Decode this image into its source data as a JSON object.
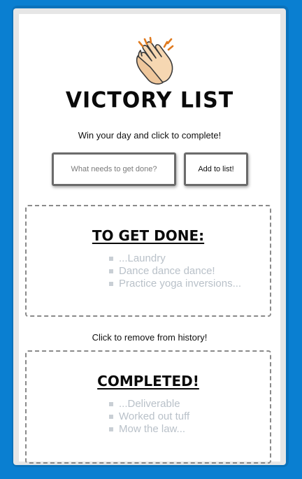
{
  "app": {
    "title": "Victory List",
    "subtitle": "Win your day and click to complete!",
    "icon": "clapping-hands-icon"
  },
  "form": {
    "input_placeholder": "What needs to get done?",
    "input_value": "",
    "add_button_label": "Add to list!"
  },
  "todo": {
    "heading": "To Get Done:",
    "items": [
      "...Laundry",
      "Dance dance dance!",
      "Practice yoga inversions..."
    ]
  },
  "history_note": "Click to remove from history!",
  "completed": {
    "heading": "Completed!",
    "items": [
      "...Deliverable",
      "Worked out tuff",
      "Mow the law..."
    ]
  },
  "colors": {
    "background": "#0a7fd1",
    "panel_text": "#b9c1c9",
    "heading_text": "#0a0a0a"
  }
}
